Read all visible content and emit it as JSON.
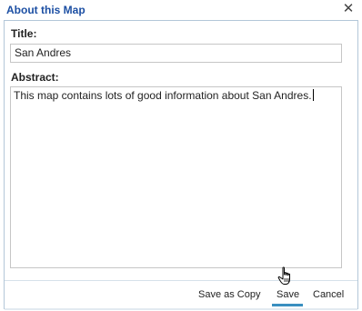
{
  "dialog": {
    "title": "About this Map",
    "close_icon": "close-icon"
  },
  "form": {
    "title_label": "Title:",
    "title_value": "San Andres",
    "abstract_label": "Abstract:",
    "abstract_value": "This map contains lots of good information about San Andres."
  },
  "footer": {
    "save_as_copy_label": "Save as Copy",
    "save_label": "Save",
    "cancel_label": "Cancel"
  },
  "cursor": {
    "icon": "hand-pointer-icon"
  }
}
